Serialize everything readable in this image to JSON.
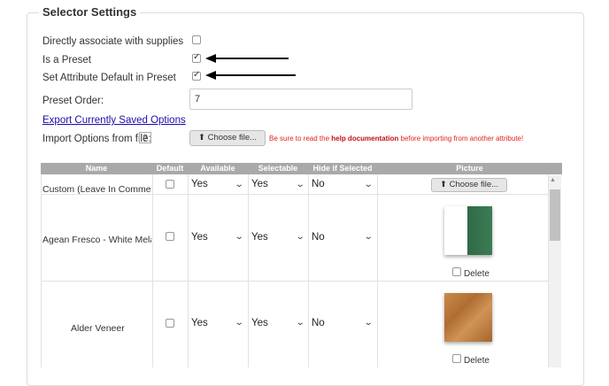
{
  "section": {
    "title": "Selector Settings"
  },
  "settings": {
    "associate_label": "Directly associate with supplies",
    "preset_label": "Is a Preset",
    "default_label": "Set Attribute Default in Preset",
    "order_label": "Preset Order:",
    "order_value": "7",
    "export_link": "Export Currently Saved Options",
    "import_label": "Import Options from file:",
    "help_q": "?",
    "choose_file": "Choose file...",
    "warning_pre": "Be sure to read the ",
    "warning_bold": "help documentation",
    "warning_post": " before importing from another attribute!"
  },
  "checkbox_state": {
    "associate": false,
    "preset": true,
    "default": true
  },
  "table": {
    "headers": [
      "Name",
      "Default",
      "Available",
      "Selectable",
      "Hide if Selected",
      "Picture"
    ],
    "choose_file": "Choose file...",
    "delete_label": "Delete",
    "rows": [
      {
        "name": "Custom (Leave In Comment",
        "available": "Yes",
        "selectable": "Yes",
        "hide": "No"
      },
      {
        "name": "Agean Fresco - White Melan",
        "available": "Yes",
        "selectable": "Yes",
        "hide": "No",
        "picture": "white-green-swatch"
      },
      {
        "name": "Alder Veneer",
        "available": "Yes",
        "selectable": "Yes",
        "hide": "No",
        "picture": "alder-wood-swatch"
      }
    ]
  },
  "colors": {
    "header_bg": "#a9a9a9",
    "warning": "#e0241a",
    "link": "#1a0dab"
  }
}
